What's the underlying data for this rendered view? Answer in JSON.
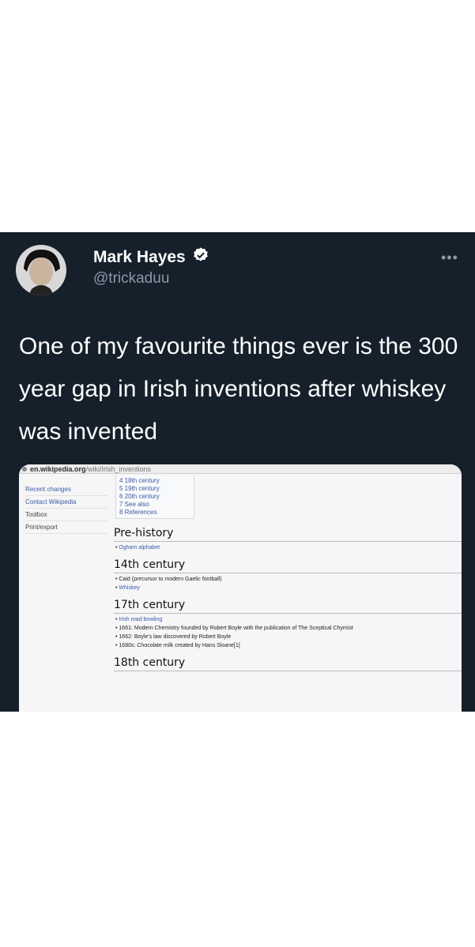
{
  "tweet": {
    "author": {
      "name": "Mark Hayes",
      "handle": "@trickaduu",
      "verified": true
    },
    "more_icon": "more-horizontal-icon",
    "text": "One of my favourite things ever is the 300 year gap in Irish inventions after whiskey was invented"
  },
  "screenshot": {
    "url_domain": "en.wikipedia.org",
    "url_path": "/wiki/Irish_inventions",
    "sidebar": [
      "Recent changes",
      "Contact Wikipedia",
      "Toolbox",
      "Print/export"
    ],
    "toc": [
      "4 18th century",
      "5 19th century",
      "6 20th century",
      "7 See also",
      "8 References"
    ],
    "sections": [
      {
        "heading": "Pre-history",
        "items": [
          "Ogham alphabet"
        ]
      },
      {
        "heading": "14th century",
        "items": [
          "Caid (precursor to modern Gaelic football)",
          "Whiskey"
        ]
      },
      {
        "heading": "17th century",
        "items": [
          "Irish road bowling",
          "1661: Modern Chemistry founded by Robert Boyle with the publication of The Sceptical Chymist",
          "1662: Boyle's law discovered by Robert Boyle",
          "1680s: Chocolate milk created by Hans Sloane[1]"
        ]
      },
      {
        "heading": "18th century",
        "items": []
      }
    ]
  },
  "colors": {
    "tweet_bg": "#15202b",
    "verified": "#ffffff",
    "link": "#3a5ba8"
  }
}
